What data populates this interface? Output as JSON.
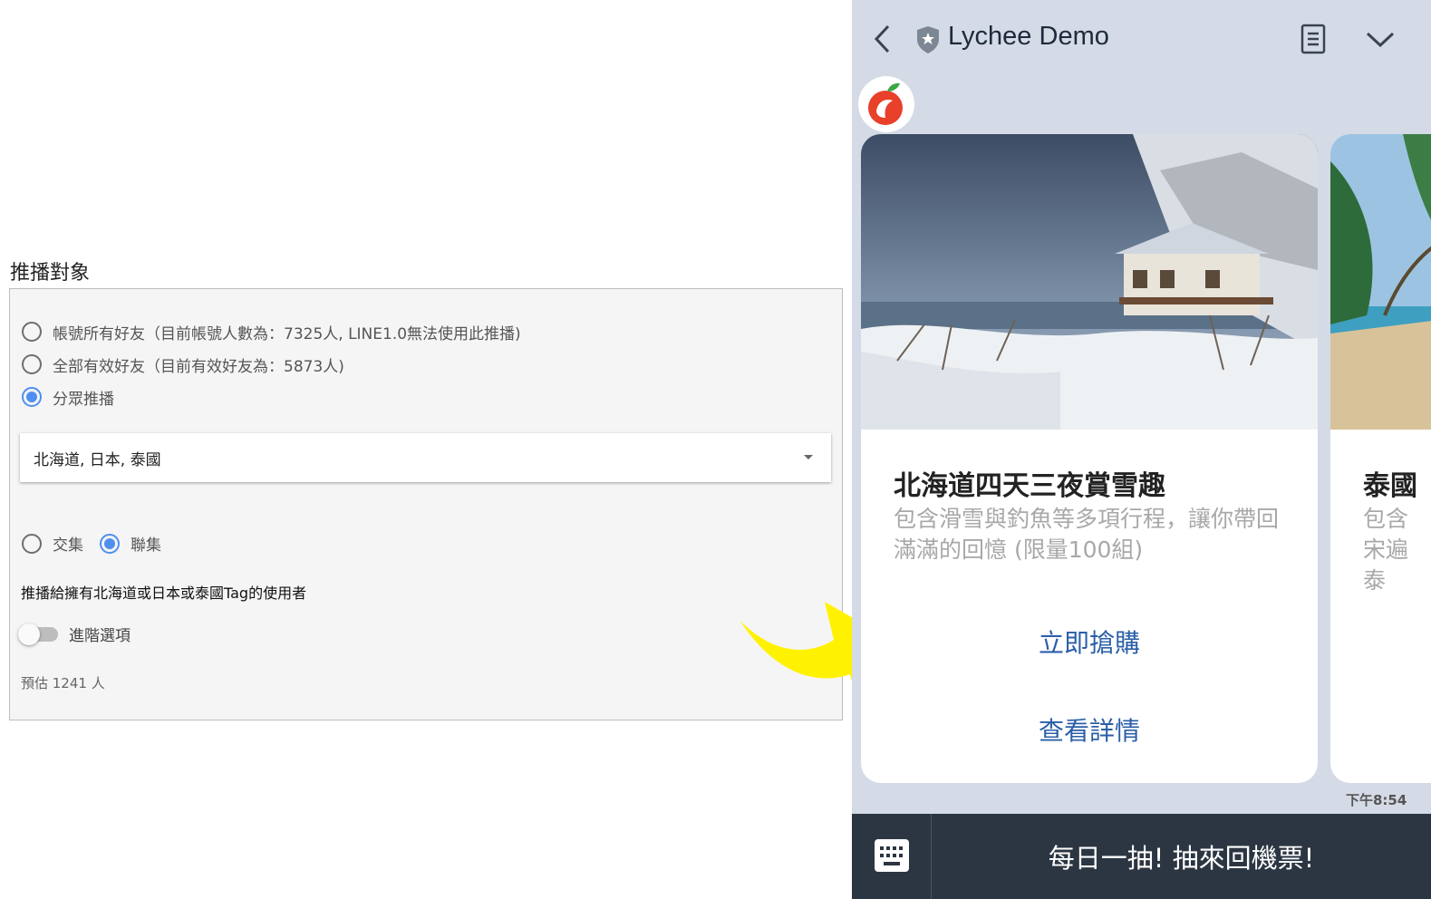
{
  "left": {
    "section_title": "推播對象",
    "audience_options": [
      {
        "label": "帳號所有好友（目前帳號人數為：7325人, LINE1.0無法使用此推播)",
        "checked": false
      },
      {
        "label": "全部有效好友（目前有效好友為：5873人)",
        "checked": false
      },
      {
        "label": "分眾推播",
        "checked": true
      }
    ],
    "tag_select_value": "北海道, 日本, 泰國",
    "set_options": [
      {
        "label": "交集",
        "checked": false
      },
      {
        "label": "聯集",
        "checked": true
      }
    ],
    "description": "推播給擁有北海道或日本或泰國Tag的使用者",
    "advanced_label": "進階選項",
    "advanced_enabled": false,
    "estimate": "預估 1241 人"
  },
  "chat": {
    "title": "Lychee Demo",
    "cards": [
      {
        "title": "北海道四天三夜賞雪趣",
        "desc": "包含滑雪與釣魚等多項行程，讓你帶回滿滿的回憶 (限量100組)",
        "buttons": [
          "立即搶購",
          "查看詳情"
        ]
      },
      {
        "title": "泰國",
        "desc": "包含宋遍泰"
      }
    ],
    "timestamp": "下午8:54",
    "rich_menu_label": "每日一抽! 抽來回機票!"
  },
  "colors": {
    "radio_accent": "#4f8ff0",
    "arrow": "#fff200",
    "chat_bg": "#d4dae6",
    "link_blue": "#2b5fa8",
    "bottom_bar": "#2c3642"
  }
}
